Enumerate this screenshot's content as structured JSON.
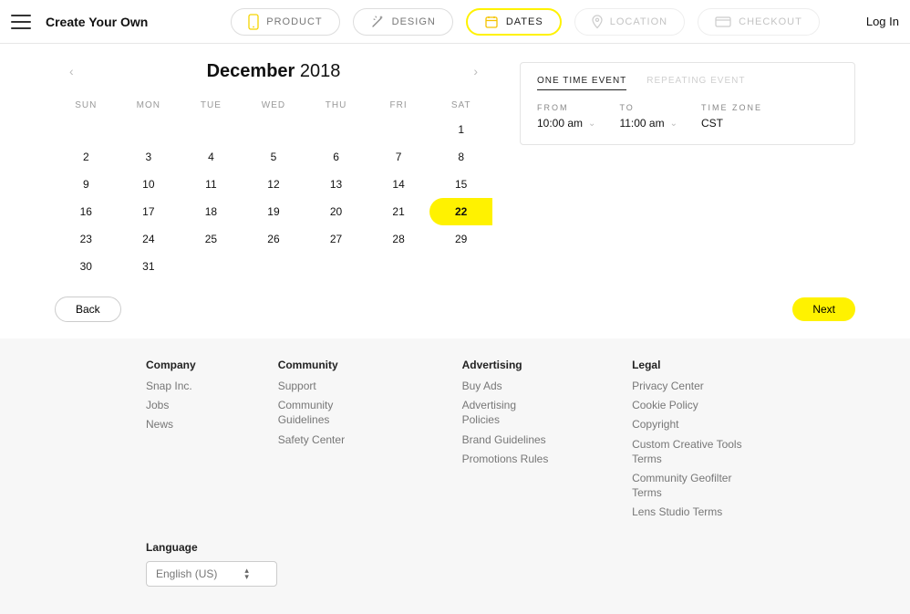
{
  "header": {
    "title": "Create Your Own",
    "login": "Log In",
    "steps": [
      {
        "id": "product",
        "label": "PRODUCT"
      },
      {
        "id": "design",
        "label": "DESIGN"
      },
      {
        "id": "dates",
        "label": "DATES"
      },
      {
        "id": "location",
        "label": "LOCATION"
      },
      {
        "id": "checkout",
        "label": "CHECKOUT"
      }
    ]
  },
  "calendar": {
    "month": "December",
    "year": "2018",
    "days_short": [
      "SUN",
      "MON",
      "TUE",
      "WED",
      "THU",
      "FRI",
      "SAT"
    ],
    "weeks": [
      [
        "",
        "",
        "",
        "",
        "",
        "",
        "1"
      ],
      [
        "2",
        "3",
        "4",
        "5",
        "6",
        "7",
        "8"
      ],
      [
        "9",
        "10",
        "11",
        "12",
        "13",
        "14",
        "15"
      ],
      [
        "16",
        "17",
        "18",
        "19",
        "20",
        "21",
        "22"
      ],
      [
        "23",
        "24",
        "25",
        "26",
        "27",
        "28",
        "29"
      ],
      [
        "30",
        "31",
        "",
        "",
        "",
        "",
        ""
      ]
    ],
    "selected_start": "22"
  },
  "event": {
    "tabs": {
      "one_time": "ONE TIME EVENT",
      "repeating": "REPEATING EVENT"
    },
    "from_label": "FROM",
    "from_value": "10:00 am",
    "to_label": "TO",
    "to_value": "11:00 am",
    "tz_label": "TIME ZONE",
    "tz_value": "CST"
  },
  "actions": {
    "back": "Back",
    "next": "Next"
  },
  "footer": {
    "company": {
      "title": "Company",
      "links": [
        "Snap Inc.",
        "Jobs",
        "News"
      ]
    },
    "community": {
      "title": "Community",
      "links": [
        "Support",
        "Community Guidelines",
        "Safety Center"
      ]
    },
    "advertising": {
      "title": "Advertising",
      "links": [
        "Buy Ads",
        "Advertising Policies",
        "Brand Guidelines",
        "Promotions Rules"
      ]
    },
    "legal": {
      "title": "Legal",
      "links": [
        "Privacy Center",
        "Cookie Policy",
        "Copyright",
        "Custom Creative Tools Terms",
        "Community Geofilter Terms",
        "Lens Studio Terms"
      ]
    },
    "language": {
      "title": "Language",
      "value": "English (US)"
    }
  }
}
